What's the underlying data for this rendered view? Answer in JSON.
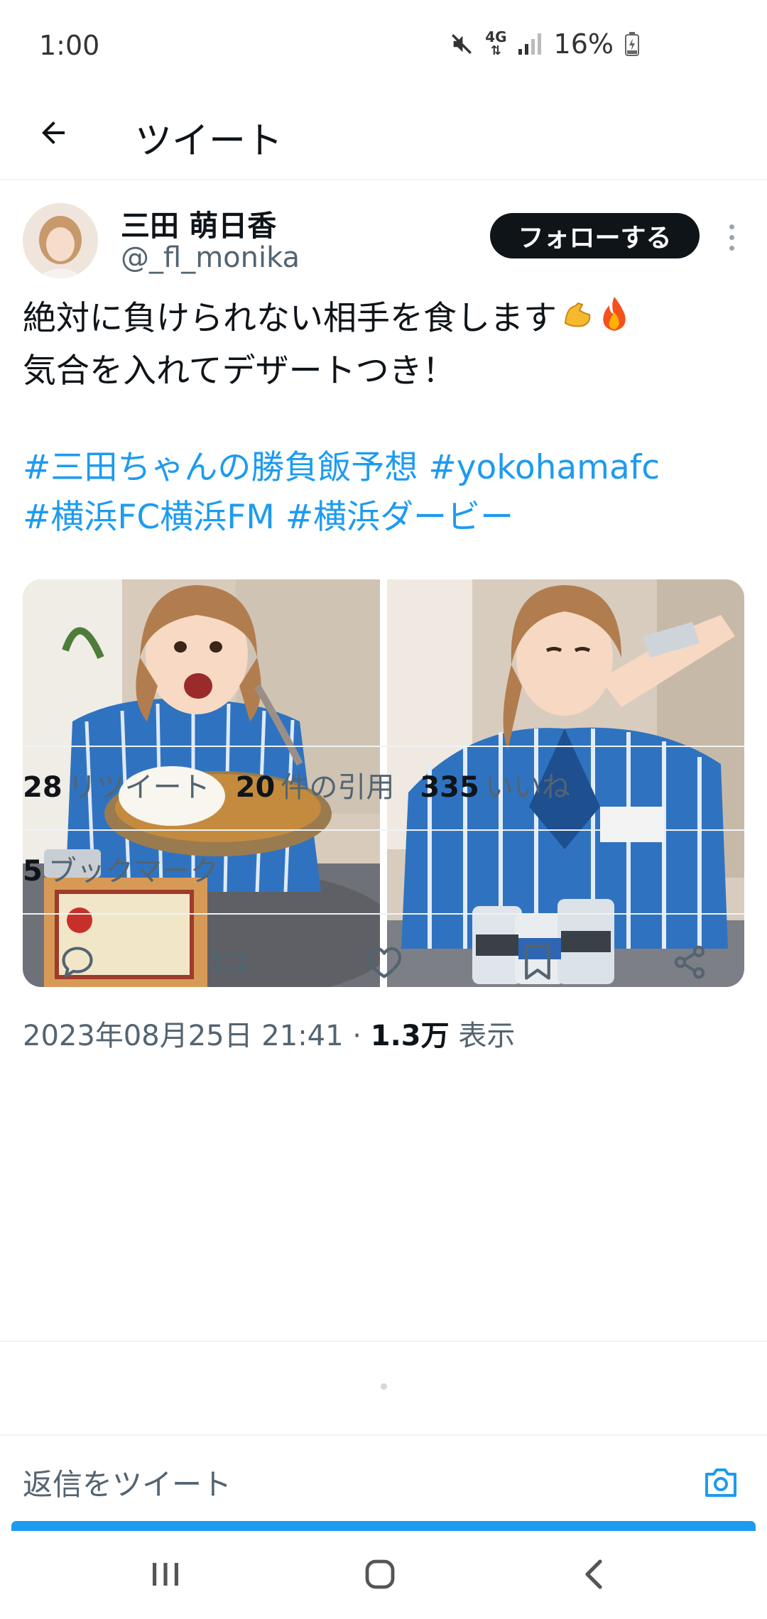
{
  "status_bar": {
    "time": "1:00",
    "network": "4G",
    "battery": "16%",
    "icons": [
      "mute-icon",
      "signal-icon",
      "battery-icon"
    ]
  },
  "header": {
    "title": "ツイート",
    "back_icon": "arrow-left-icon"
  },
  "tweet": {
    "author": {
      "name": "三田 萌日香",
      "handle": "@_fl_monika"
    },
    "follow_label": "フォローする",
    "text_lines": [
      "絶対に負けられない相手を食します",
      "気合を入れてデザートつき！"
    ],
    "emojis": [
      "flexed-biceps-emoji",
      "fire-emoji"
    ],
    "hashtag_lines": [
      "#三田ちゃんの勝負飯予想 #yokohamafc",
      "#横浜FC横浜FM #横浜ダービー"
    ],
    "media": [
      {
        "description": "photo-curry"
      },
      {
        "description": "photo-jelly-drink"
      }
    ],
    "timestamp": "2023年08月25日 21:41",
    "separator": " · ",
    "views_count": "1.3万",
    "views_label": " 表示",
    "stats": {
      "retweets": {
        "count": "28",
        "label": "リツイート"
      },
      "quotes": {
        "count": "20",
        "label": "件の引用"
      },
      "likes": {
        "count": "335",
        "label": "いいね"
      },
      "bookmarks": {
        "count": "5",
        "label": "ブックマーク"
      }
    },
    "actions": [
      "reply-icon",
      "retweet-icon",
      "like-icon",
      "bookmark-icon",
      "share-icon"
    ]
  },
  "reply": {
    "placeholder": "返信をツイート",
    "camera_icon": "camera-icon"
  },
  "colors": {
    "accent": "#1d9bf0",
    "text": "#0f1419",
    "secondary": "#536471",
    "divider": "#eff3f4"
  },
  "system_nav": [
    "recents-icon",
    "home-icon",
    "back-icon"
  ]
}
